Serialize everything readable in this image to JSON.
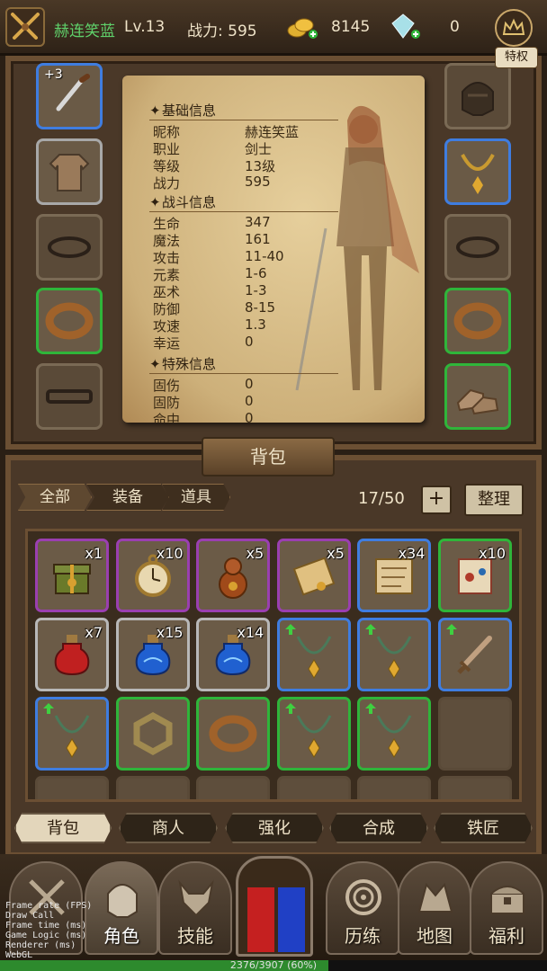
{
  "header": {
    "player_name": "赫连笑蓝",
    "level": "Lv.13",
    "power": "战力: 595",
    "gold": "8145",
    "gems": "0",
    "privilege_label": "特权"
  },
  "equipment": {
    "weapon_bonus": "+3"
  },
  "info": {
    "sections": {
      "basic": "基础信息",
      "combat": "战斗信息",
      "special": "特殊信息"
    },
    "basic_rows": [
      {
        "k": "昵称",
        "v": "赫连笑蓝"
      },
      {
        "k": "职业",
        "v": "剑士"
      },
      {
        "k": "等级",
        "v": "13级"
      },
      {
        "k": "战力",
        "v": "595"
      }
    ],
    "combat_rows": [
      {
        "k": "生命",
        "v": "347"
      },
      {
        "k": "魔法",
        "v": "161"
      },
      {
        "k": "攻击",
        "v": "11-40"
      },
      {
        "k": "元素",
        "v": "1-6"
      },
      {
        "k": "巫术",
        "v": "1-3"
      },
      {
        "k": "防御",
        "v": "8-15"
      },
      {
        "k": "攻速",
        "v": "1.3"
      },
      {
        "k": "幸运",
        "v": "0"
      }
    ],
    "special_rows": [
      {
        "k": "固伤",
        "v": "0"
      },
      {
        "k": "固防",
        "v": "0"
      },
      {
        "k": "命中",
        "v": "0"
      }
    ]
  },
  "bag": {
    "title": "背包",
    "filters": [
      "全部",
      "装备",
      "道具"
    ],
    "count": "17/50",
    "add_label": "+",
    "sort_label": "整理",
    "items": [
      {
        "icon": "gift-box-icon",
        "qty": "x1",
        "rarity": "purple"
      },
      {
        "icon": "pocket-watch-icon",
        "qty": "x10",
        "rarity": "purple"
      },
      {
        "icon": "gourd-potion-icon",
        "qty": "x5",
        "rarity": "purple"
      },
      {
        "icon": "scroll-icon",
        "qty": "x5",
        "rarity": "purple"
      },
      {
        "icon": "map-scroll-icon",
        "qty": "x34",
        "rarity": "blue"
      },
      {
        "icon": "recipe-scroll-icon",
        "qty": "x10",
        "rarity": "green"
      },
      {
        "icon": "red-potion-icon",
        "qty": "x7",
        "rarity": "white"
      },
      {
        "icon": "blue-potion-icon",
        "qty": "x15",
        "rarity": "white"
      },
      {
        "icon": "blue-potion-icon",
        "qty": "x14",
        "rarity": "white"
      },
      {
        "icon": "necklace-icon",
        "qty": "",
        "rarity": "blue",
        "upgrade": true
      },
      {
        "icon": "necklace-icon",
        "qty": "",
        "rarity": "blue",
        "upgrade": true
      },
      {
        "icon": "sword-icon",
        "qty": "",
        "rarity": "blue",
        "upgrade": true
      },
      {
        "icon": "necklace-icon",
        "qty": "",
        "rarity": "blue",
        "upgrade": true
      },
      {
        "icon": "hex-ring-icon",
        "qty": "",
        "rarity": "green"
      },
      {
        "icon": "ring-icon",
        "qty": "",
        "rarity": "green"
      },
      {
        "icon": "necklace-icon",
        "qty": "",
        "rarity": "green",
        "upgrade": true
      },
      {
        "icon": "necklace-icon",
        "qty": "",
        "rarity": "green",
        "upgrade": true
      },
      {
        "icon": "",
        "qty": "",
        "rarity": "empty"
      }
    ]
  },
  "subtabs": [
    "背包",
    "商人",
    "强化",
    "合成",
    "铁匠"
  ],
  "nav": {
    "items": [
      "角色",
      "技能",
      "历练",
      "地图",
      "福利"
    ]
  },
  "debug_lines": "Frame rate (FPS)\nDraw Call\nFrame time (ms)\nGame Logic (ms)\nRenderer (ms)\nWebGL",
  "loading": {
    "text": "2376/3907 (60%)",
    "progress": 0.6
  }
}
